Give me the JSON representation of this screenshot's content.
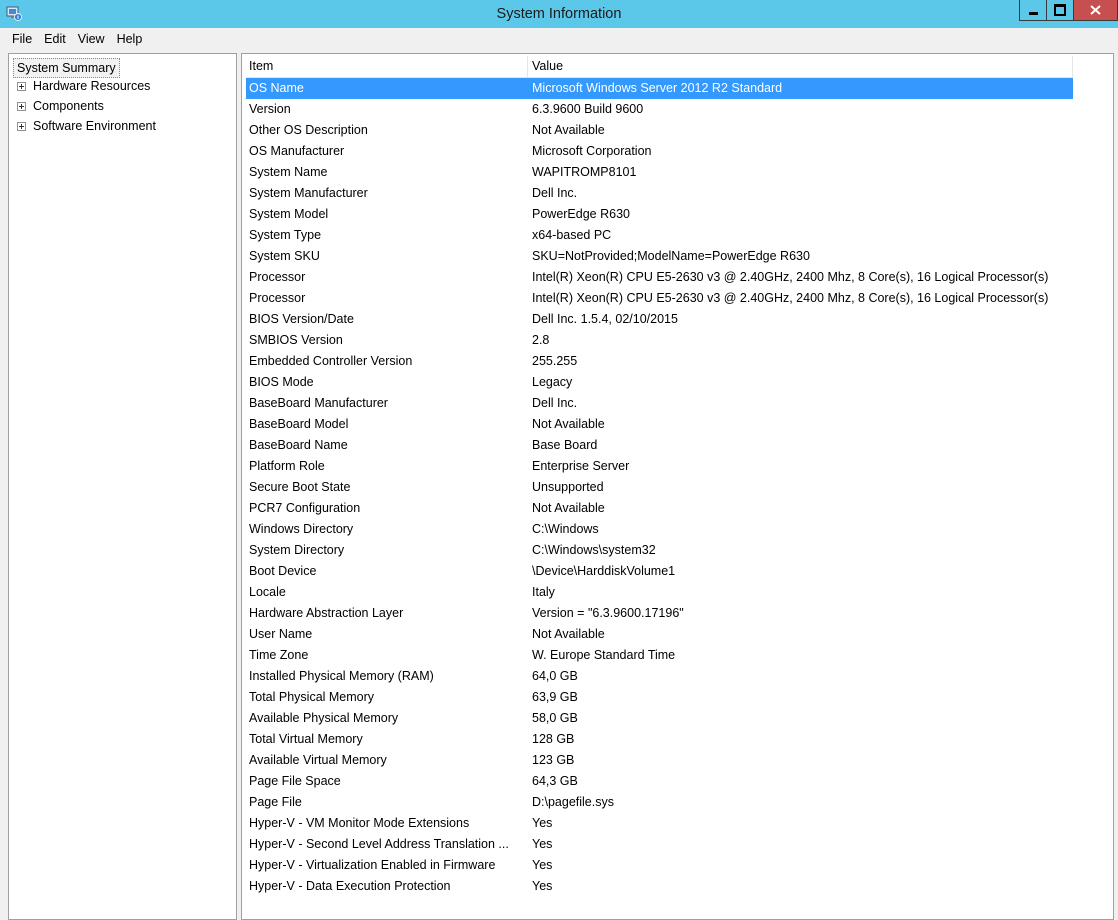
{
  "window": {
    "title": "System Information"
  },
  "menu": [
    "File",
    "Edit",
    "View",
    "Help"
  ],
  "tree": {
    "root": "System Summary",
    "children": [
      "Hardware Resources",
      "Components",
      "Software Environment"
    ]
  },
  "table": {
    "headers": {
      "item": "Item",
      "value": "Value"
    },
    "selected_row": 0,
    "rows": [
      {
        "item": "OS Name",
        "value": "Microsoft Windows Server 2012 R2 Standard"
      },
      {
        "item": "Version",
        "value": "6.3.9600 Build 9600"
      },
      {
        "item": "Other OS Description",
        "value": "Not Available"
      },
      {
        "item": "OS Manufacturer",
        "value": "Microsoft Corporation"
      },
      {
        "item": "System Name",
        "value": "WAPITROMP8101"
      },
      {
        "item": "System Manufacturer",
        "value": "Dell Inc."
      },
      {
        "item": "System Model",
        "value": "PowerEdge R630"
      },
      {
        "item": "System Type",
        "value": "x64-based PC"
      },
      {
        "item": "System SKU",
        "value": "SKU=NotProvided;ModelName=PowerEdge R630"
      },
      {
        "item": "Processor",
        "value": "Intel(R) Xeon(R) CPU E5-2630 v3 @ 2.40GHz, 2400 Mhz, 8 Core(s), 16 Logical Processor(s)"
      },
      {
        "item": "Processor",
        "value": "Intel(R) Xeon(R) CPU E5-2630 v3 @ 2.40GHz, 2400 Mhz, 8 Core(s), 16 Logical Processor(s)"
      },
      {
        "item": "BIOS Version/Date",
        "value": "Dell Inc. 1.5.4, 02/10/2015"
      },
      {
        "item": "SMBIOS Version",
        "value": "2.8"
      },
      {
        "item": "Embedded Controller Version",
        "value": "255.255"
      },
      {
        "item": "BIOS Mode",
        "value": "Legacy"
      },
      {
        "item": "BaseBoard Manufacturer",
        "value": "Dell Inc."
      },
      {
        "item": "BaseBoard Model",
        "value": "Not Available"
      },
      {
        "item": "BaseBoard Name",
        "value": "Base Board"
      },
      {
        "item": "Platform Role",
        "value": "Enterprise Server"
      },
      {
        "item": "Secure Boot State",
        "value": "Unsupported"
      },
      {
        "item": "PCR7 Configuration",
        "value": "Not Available"
      },
      {
        "item": "Windows Directory",
        "value": "C:\\Windows"
      },
      {
        "item": "System Directory",
        "value": "C:\\Windows\\system32"
      },
      {
        "item": "Boot Device",
        "value": "\\Device\\HarddiskVolume1"
      },
      {
        "item": "Locale",
        "value": "Italy"
      },
      {
        "item": "Hardware Abstraction Layer",
        "value": "Version = \"6.3.9600.17196\""
      },
      {
        "item": "User Name",
        "value": "Not Available"
      },
      {
        "item": "Time Zone",
        "value": "W. Europe Standard Time"
      },
      {
        "item": "Installed Physical Memory (RAM)",
        "value": "64,0 GB"
      },
      {
        "item": "Total Physical Memory",
        "value": "63,9 GB"
      },
      {
        "item": "Available Physical Memory",
        "value": "58,0 GB"
      },
      {
        "item": "Total Virtual Memory",
        "value": "128 GB"
      },
      {
        "item": "Available Virtual Memory",
        "value": "123 GB"
      },
      {
        "item": "Page File Space",
        "value": "64,3 GB"
      },
      {
        "item": "Page File",
        "value": "D:\\pagefile.sys"
      },
      {
        "item": "Hyper-V - VM Monitor Mode Extensions",
        "value": "Yes"
      },
      {
        "item": "Hyper-V - Second Level Address Translation ...",
        "value": "Yes"
      },
      {
        "item": "Hyper-V - Virtualization Enabled in Firmware",
        "value": "Yes"
      },
      {
        "item": "Hyper-V - Data Execution Protection",
        "value": "Yes"
      }
    ]
  },
  "colors": {
    "titlebar": "#5bc8ea",
    "selection": "#3399ff",
    "close": "#c74f4f"
  },
  "icons": {
    "app": "system-information-icon",
    "minimize": "minimize-icon",
    "maximize": "maximize-icon",
    "close": "close-icon"
  }
}
